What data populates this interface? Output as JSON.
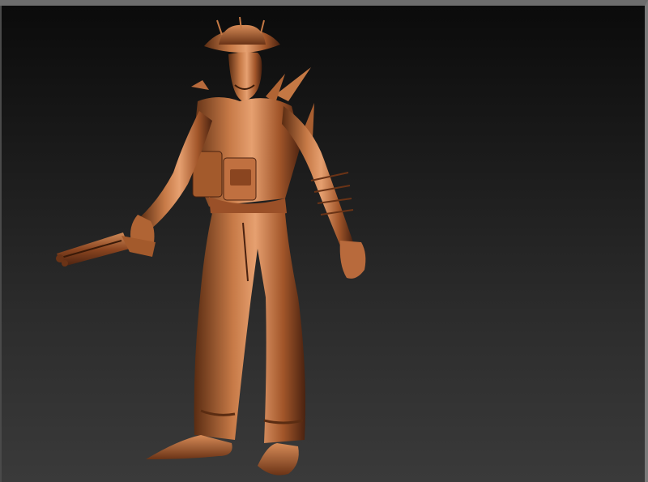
{
  "viewport": {
    "name": "3d-sculpt-viewport",
    "background_top": "#0b0b0b",
    "background_bottom": "#3a3a3a",
    "frame_color": "#6d6d6d"
  },
  "model": {
    "icon": "sculpted-character-model",
    "material_color": "#b86a3c",
    "highlight_color": "#e6a070",
    "shadow_color": "#4a2210"
  }
}
